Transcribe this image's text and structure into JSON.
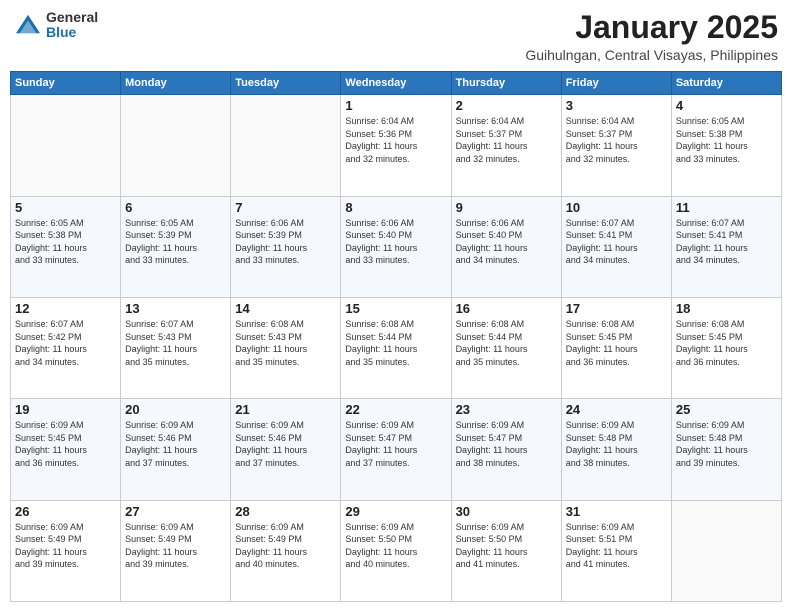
{
  "logo": {
    "general": "General",
    "blue": "Blue"
  },
  "title": {
    "month": "January 2025",
    "location": "Guihulngan, Central Visayas, Philippines"
  },
  "weekdays": [
    "Sunday",
    "Monday",
    "Tuesday",
    "Wednesday",
    "Thursday",
    "Friday",
    "Saturday"
  ],
  "weeks": [
    [
      {
        "day": "",
        "info": ""
      },
      {
        "day": "",
        "info": ""
      },
      {
        "day": "",
        "info": ""
      },
      {
        "day": "1",
        "info": "Sunrise: 6:04 AM\nSunset: 5:36 PM\nDaylight: 11 hours\nand 32 minutes."
      },
      {
        "day": "2",
        "info": "Sunrise: 6:04 AM\nSunset: 5:37 PM\nDaylight: 11 hours\nand 32 minutes."
      },
      {
        "day": "3",
        "info": "Sunrise: 6:04 AM\nSunset: 5:37 PM\nDaylight: 11 hours\nand 32 minutes."
      },
      {
        "day": "4",
        "info": "Sunrise: 6:05 AM\nSunset: 5:38 PM\nDaylight: 11 hours\nand 33 minutes."
      }
    ],
    [
      {
        "day": "5",
        "info": "Sunrise: 6:05 AM\nSunset: 5:38 PM\nDaylight: 11 hours\nand 33 minutes."
      },
      {
        "day": "6",
        "info": "Sunrise: 6:05 AM\nSunset: 5:39 PM\nDaylight: 11 hours\nand 33 minutes."
      },
      {
        "day": "7",
        "info": "Sunrise: 6:06 AM\nSunset: 5:39 PM\nDaylight: 11 hours\nand 33 minutes."
      },
      {
        "day": "8",
        "info": "Sunrise: 6:06 AM\nSunset: 5:40 PM\nDaylight: 11 hours\nand 33 minutes."
      },
      {
        "day": "9",
        "info": "Sunrise: 6:06 AM\nSunset: 5:40 PM\nDaylight: 11 hours\nand 34 minutes."
      },
      {
        "day": "10",
        "info": "Sunrise: 6:07 AM\nSunset: 5:41 PM\nDaylight: 11 hours\nand 34 minutes."
      },
      {
        "day": "11",
        "info": "Sunrise: 6:07 AM\nSunset: 5:41 PM\nDaylight: 11 hours\nand 34 minutes."
      }
    ],
    [
      {
        "day": "12",
        "info": "Sunrise: 6:07 AM\nSunset: 5:42 PM\nDaylight: 11 hours\nand 34 minutes."
      },
      {
        "day": "13",
        "info": "Sunrise: 6:07 AM\nSunset: 5:43 PM\nDaylight: 11 hours\nand 35 minutes."
      },
      {
        "day": "14",
        "info": "Sunrise: 6:08 AM\nSunset: 5:43 PM\nDaylight: 11 hours\nand 35 minutes."
      },
      {
        "day": "15",
        "info": "Sunrise: 6:08 AM\nSunset: 5:44 PM\nDaylight: 11 hours\nand 35 minutes."
      },
      {
        "day": "16",
        "info": "Sunrise: 6:08 AM\nSunset: 5:44 PM\nDaylight: 11 hours\nand 35 minutes."
      },
      {
        "day": "17",
        "info": "Sunrise: 6:08 AM\nSunset: 5:45 PM\nDaylight: 11 hours\nand 36 minutes."
      },
      {
        "day": "18",
        "info": "Sunrise: 6:08 AM\nSunset: 5:45 PM\nDaylight: 11 hours\nand 36 minutes."
      }
    ],
    [
      {
        "day": "19",
        "info": "Sunrise: 6:09 AM\nSunset: 5:45 PM\nDaylight: 11 hours\nand 36 minutes."
      },
      {
        "day": "20",
        "info": "Sunrise: 6:09 AM\nSunset: 5:46 PM\nDaylight: 11 hours\nand 37 minutes."
      },
      {
        "day": "21",
        "info": "Sunrise: 6:09 AM\nSunset: 5:46 PM\nDaylight: 11 hours\nand 37 minutes."
      },
      {
        "day": "22",
        "info": "Sunrise: 6:09 AM\nSunset: 5:47 PM\nDaylight: 11 hours\nand 37 minutes."
      },
      {
        "day": "23",
        "info": "Sunrise: 6:09 AM\nSunset: 5:47 PM\nDaylight: 11 hours\nand 38 minutes."
      },
      {
        "day": "24",
        "info": "Sunrise: 6:09 AM\nSunset: 5:48 PM\nDaylight: 11 hours\nand 38 minutes."
      },
      {
        "day": "25",
        "info": "Sunrise: 6:09 AM\nSunset: 5:48 PM\nDaylight: 11 hours\nand 39 minutes."
      }
    ],
    [
      {
        "day": "26",
        "info": "Sunrise: 6:09 AM\nSunset: 5:49 PM\nDaylight: 11 hours\nand 39 minutes."
      },
      {
        "day": "27",
        "info": "Sunrise: 6:09 AM\nSunset: 5:49 PM\nDaylight: 11 hours\nand 39 minutes."
      },
      {
        "day": "28",
        "info": "Sunrise: 6:09 AM\nSunset: 5:49 PM\nDaylight: 11 hours\nand 40 minutes."
      },
      {
        "day": "29",
        "info": "Sunrise: 6:09 AM\nSunset: 5:50 PM\nDaylight: 11 hours\nand 40 minutes."
      },
      {
        "day": "30",
        "info": "Sunrise: 6:09 AM\nSunset: 5:50 PM\nDaylight: 11 hours\nand 41 minutes."
      },
      {
        "day": "31",
        "info": "Sunrise: 6:09 AM\nSunset: 5:51 PM\nDaylight: 11 hours\nand 41 minutes."
      },
      {
        "day": "",
        "info": ""
      }
    ]
  ]
}
